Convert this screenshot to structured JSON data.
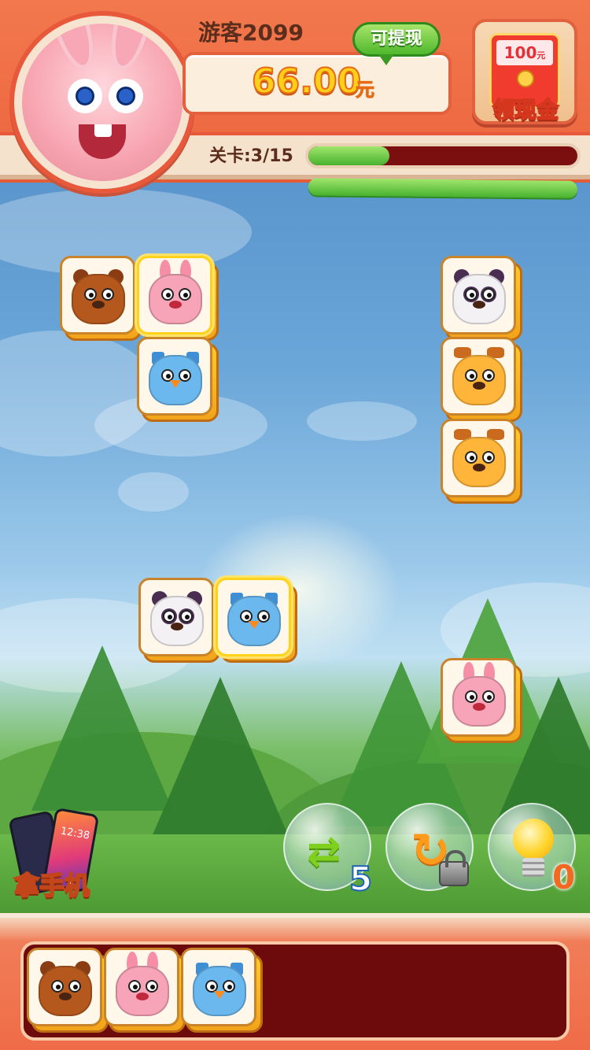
{
  "header": {
    "player_name": "游客2099",
    "cash_amount": "66.00",
    "cash_unit": "元",
    "withdraw_label": "可提现",
    "redpack_value": "100",
    "redpack_unit": "元",
    "redpack_label": "领现金",
    "level_label": "关卡:3/15",
    "level_progress": 0.3
  },
  "board": {
    "tiles": [
      {
        "animal": "bear",
        "selected": false
      },
      {
        "animal": "bunny",
        "selected": true
      },
      {
        "animal": "owl",
        "selected": false
      },
      {
        "animal": "panda",
        "selected": false
      },
      {
        "animal": "deer",
        "selected": false
      },
      {
        "animal": "deer",
        "selected": false
      },
      {
        "animal": "panda",
        "selected": false
      },
      {
        "animal": "owl",
        "selected": true
      },
      {
        "animal": "bunny",
        "selected": false
      }
    ]
  },
  "tools": {
    "shuffle_count": "5",
    "hint_count": "0",
    "undo_locked": true
  },
  "promo": {
    "label": "拿手机",
    "phone_time": "12:38"
  },
  "tray": {
    "slots": [
      "bear",
      "bunny",
      "owl"
    ]
  },
  "colors": {
    "header": "#ee6a43",
    "tray": "#6d0a0c",
    "tile_side": "#ffc928",
    "accent_green": "#48b22f"
  }
}
